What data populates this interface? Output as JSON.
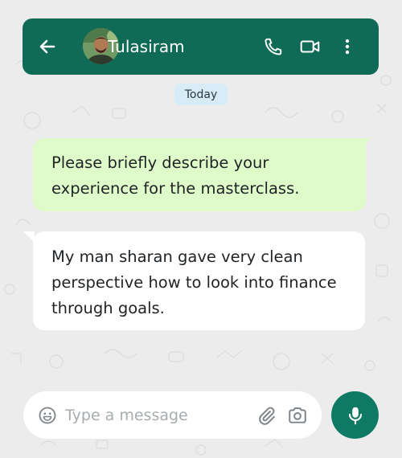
{
  "header": {
    "back_icon": "arrow-left-icon",
    "contact_name": "Tulasiram",
    "call_icon": "phone-icon",
    "video_icon": "video-camera-icon",
    "menu_icon": "more-vertical-icon"
  },
  "date_chip": "Today",
  "messages": [
    {
      "direction": "outgoing",
      "text": "Please briefly describe your experience for the masterclass."
    },
    {
      "direction": "incoming",
      "text": "My man sharan gave very clean perspective how to look into finance through goals."
    }
  ],
  "composer": {
    "emoji_icon": "emoji-icon",
    "placeholder": "Type a message",
    "value": "",
    "attach_icon": "paperclip-icon",
    "camera_icon": "camera-icon"
  },
  "mic_icon": "microphone-icon",
  "colors": {
    "header_bg": "#0f6b55",
    "chat_bg": "#ececec",
    "outgoing_bubble": "#dffbc9",
    "incoming_bubble": "#ffffff",
    "date_chip_bg": "#d6ecf7",
    "mic_button": "#0f7a63"
  }
}
